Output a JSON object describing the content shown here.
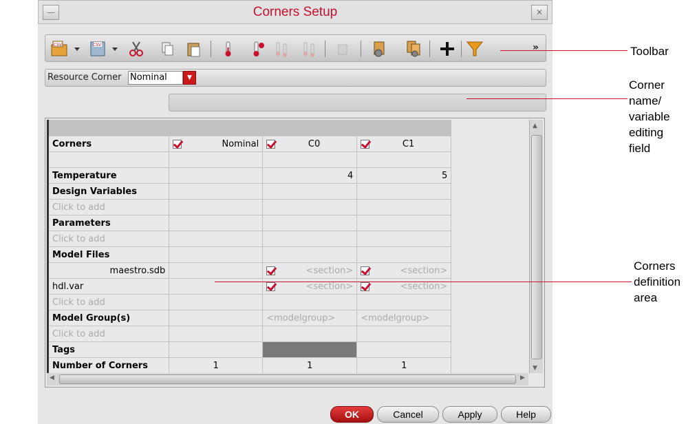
{
  "window": {
    "title": "Corners Setup"
  },
  "toolbar": {
    "icons": [
      "open-csv-icon",
      "save-csv-icon",
      "cut-icon",
      "copy-icon",
      "paste-icon",
      "add-temperature-icon",
      "remove-temperature-icon",
      "sweep-up-icon",
      "sweep-down-icon",
      "disabled-icon",
      "corner-settings-icon",
      "corner-settings-multi-icon",
      "add-icon",
      "filter-icon"
    ],
    "more": "»"
  },
  "resource_corner": {
    "label": "Resource Corner",
    "value": "Nominal"
  },
  "grid": {
    "columns": [
      {
        "name": "Nominal",
        "checked": true
      },
      {
        "name": "C0",
        "checked": true
      },
      {
        "name": "C1",
        "checked": true
      }
    ],
    "rows": {
      "corners": "Corners",
      "temperature": {
        "label": "Temperature",
        "values": [
          "",
          "4",
          "5"
        ]
      },
      "design_variables": "Design Variables",
      "parameters": "Parameters",
      "model_files": "Model Files",
      "model_file_1": "maestro.sdb",
      "model_file_2": "hdl.var",
      "section": "<section>",
      "model_groups": "Model Group(s)",
      "modelgroup": "<modelgroup>",
      "tags": "Tags",
      "number_of_corners": {
        "label": "Number of Corners",
        "values": [
          "1",
          "1",
          "1"
        ]
      },
      "click_to_add": "Click to add"
    }
  },
  "buttons": {
    "ok": "OK",
    "cancel": "Cancel",
    "apply": "Apply",
    "help": "Help"
  },
  "callouts": {
    "toolbar": "Toolbar",
    "name_field_1": "Corner",
    "name_field_2": "name/",
    "name_field_3": "variable",
    "name_field_4": "editing",
    "name_field_5": "field",
    "definition_1": "Corners",
    "definition_2": "definition",
    "definition_3": "area"
  },
  "colors": {
    "accent": "#c8102e",
    "ok_button": "#c41a1a"
  }
}
